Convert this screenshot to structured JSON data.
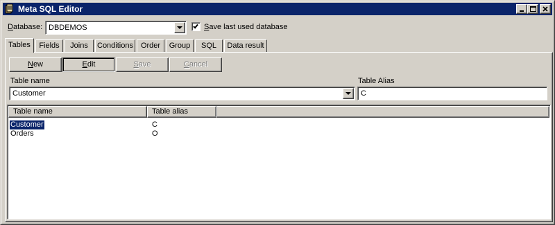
{
  "window": {
    "title": "Meta SQL Editor",
    "accent": "#0a246a",
    "icons": [
      "app-icon",
      "minimize-icon",
      "maximize-icon",
      "close-icon"
    ]
  },
  "database": {
    "label_prefix": "",
    "label_hotkey": "D",
    "label_rest": "atabase:",
    "value": "DBDEMOS"
  },
  "save_last": {
    "checked": true,
    "label_hotkey": "S",
    "label_rest": "ave last used database"
  },
  "tabs": [
    {
      "label": "Tables"
    },
    {
      "label": "Fields"
    },
    {
      "label": "Joins"
    },
    {
      "label": "Conditions"
    },
    {
      "label": "Order"
    },
    {
      "label": "Group"
    },
    {
      "label": "SQL"
    },
    {
      "label": "Data result"
    }
  ],
  "toolbar": {
    "new": {
      "hotkey": "N",
      "rest": "ew"
    },
    "edit": {
      "hotkey": "E",
      "rest": "dit"
    },
    "save": {
      "hotkey": "S",
      "rest": "ave"
    },
    "cancel": {
      "hotkey": "C",
      "rest": "ancel"
    }
  },
  "form": {
    "table_name_label": "Table name",
    "table_name_value": "Customer",
    "table_alias_label": "Table Alias",
    "table_alias_value": "C"
  },
  "list": {
    "columns": [
      "Table name",
      "Table alias"
    ],
    "rows": [
      {
        "name": "Customer",
        "alias": "C",
        "selected": true
      },
      {
        "name": "Orders",
        "alias": "O",
        "selected": false
      }
    ]
  }
}
